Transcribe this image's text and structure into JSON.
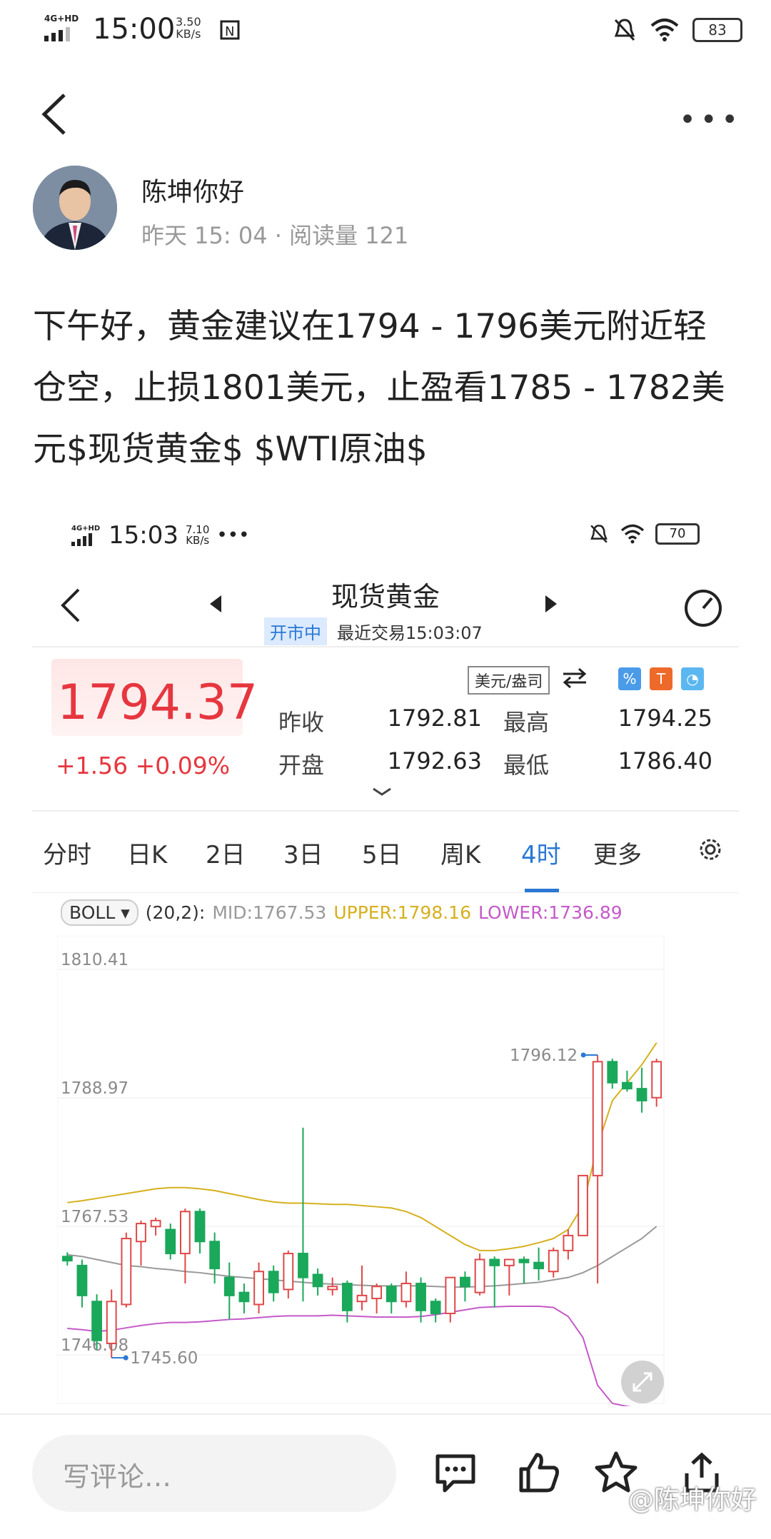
{
  "status_bar": {
    "network": "4G+HD",
    "time": "15:00",
    "speed": "3.50",
    "speed_unit": "KB/s",
    "battery": "83"
  },
  "post": {
    "author": "陈坤你好",
    "time": "昨天 15: 04",
    "reads": "阅读量 121",
    "body": "下午好，黄金建议在1794 - 1796美元附近轻仓空，止损1801美元，止盈看1785 - 1782美元$现货黄金$ $WTI原油$"
  },
  "embedded": {
    "status_bar": {
      "network": "4G+HD",
      "time": "15:03",
      "speed": "7.10",
      "speed_unit": "KB/s",
      "battery": "70"
    },
    "title": "现货黄金",
    "market_status": "开市中",
    "last_trade": "最近交易15:03:07",
    "price": "1794.37",
    "change": "+1.56 +0.09%",
    "unit": "美元/盎司",
    "quote": {
      "prev_close_label": "昨收",
      "prev_close": "1792.81",
      "high_label": "最高",
      "high": "1794.25",
      "open_label": "开盘",
      "open": "1792.63",
      "low_label": "最低",
      "low": "1786.40"
    },
    "tabs": [
      "分时",
      "日K",
      "2日",
      "3日",
      "5日",
      "周K",
      "4时",
      "更多"
    ],
    "active_tab": "4时",
    "indicator": {
      "name": "BOLL",
      "params": "(20,2):",
      "mid": "MID:1767.53",
      "upper": "UPPER:1798.16",
      "lower": "LOWER:1736.89"
    },
    "colors": {
      "up": "#e04848",
      "down": "#1aa85a",
      "mid": "#999999",
      "upper": "#d6b01e",
      "lower": "#c45ac9",
      "accent": "#2b78d6"
    }
  },
  "chart_data": {
    "type": "candlestick",
    "y_ticks": [
      "1810.41",
      "1788.97",
      "1767.53",
      "1746.08"
    ],
    "annotations": {
      "high": "1796.12",
      "low": "1745.60"
    },
    "candles": [
      {
        "o": 1762.5,
        "h": 1763.2,
        "l": 1761.0,
        "c": 1761.8
      },
      {
        "o": 1761.0,
        "h": 1762.0,
        "l": 1754.0,
        "c": 1756.0
      },
      {
        "o": 1755.0,
        "h": 1756.2,
        "l": 1747.0,
        "c": 1748.5
      },
      {
        "o": 1748.0,
        "h": 1757.0,
        "l": 1745.6,
        "c": 1755.0
      },
      {
        "o": 1754.5,
        "h": 1766.5,
        "l": 1754.0,
        "c": 1765.5
      },
      {
        "o": 1765.0,
        "h": 1768.5,
        "l": 1761.0,
        "c": 1768.0
      },
      {
        "o": 1767.5,
        "h": 1769.0,
        "l": 1766.0,
        "c": 1768.5
      },
      {
        "o": 1767.0,
        "h": 1768.0,
        "l": 1762.0,
        "c": 1763.0
      },
      {
        "o": 1763.0,
        "h": 1770.5,
        "l": 1758.0,
        "c": 1770.0
      },
      {
        "o": 1770.0,
        "h": 1770.5,
        "l": 1763.0,
        "c": 1765.0
      },
      {
        "o": 1765.0,
        "h": 1766.5,
        "l": 1758.0,
        "c": 1760.5
      },
      {
        "o": 1759.0,
        "h": 1761.5,
        "l": 1752.0,
        "c": 1756.0
      },
      {
        "o": 1756.5,
        "h": 1758.0,
        "l": 1753.0,
        "c": 1755.0
      },
      {
        "o": 1754.5,
        "h": 1761.5,
        "l": 1753.0,
        "c": 1760.0
      },
      {
        "o": 1760.0,
        "h": 1761.0,
        "l": 1755.0,
        "c": 1756.5
      },
      {
        "o": 1757.0,
        "h": 1763.5,
        "l": 1755.5,
        "c": 1763.0
      },
      {
        "o": 1763.0,
        "h": 1784.0,
        "l": 1755.0,
        "c": 1759.0
      },
      {
        "o": 1759.5,
        "h": 1760.5,
        "l": 1756.0,
        "c": 1757.5
      },
      {
        "o": 1757.0,
        "h": 1759.0,
        "l": 1756.0,
        "c": 1757.5
      },
      {
        "o": 1758.0,
        "h": 1758.5,
        "l": 1751.5,
        "c": 1753.5
      },
      {
        "o": 1755.0,
        "h": 1761.0,
        "l": 1753.5,
        "c": 1756.0
      },
      {
        "o": 1755.5,
        "h": 1758.0,
        "l": 1753.0,
        "c": 1757.5
      },
      {
        "o": 1757.5,
        "h": 1758.0,
        "l": 1753.0,
        "c": 1755.0
      },
      {
        "o": 1755.0,
        "h": 1760.0,
        "l": 1754.0,
        "c": 1758.0
      },
      {
        "o": 1758.0,
        "h": 1759.0,
        "l": 1751.5,
        "c": 1753.5
      },
      {
        "o": 1755.0,
        "h": 1755.5,
        "l": 1751.5,
        "c": 1753.0
      },
      {
        "o": 1753.0,
        "h": 1759.0,
        "l": 1751.5,
        "c": 1759.0
      },
      {
        "o": 1759.0,
        "h": 1760.0,
        "l": 1755.0,
        "c": 1757.5
      },
      {
        "o": 1756.5,
        "h": 1763.0,
        "l": 1756.0,
        "c": 1762.0
      },
      {
        "o": 1762.0,
        "h": 1762.5,
        "l": 1754.0,
        "c": 1761.0
      },
      {
        "o": 1761.0,
        "h": 1762.0,
        "l": 1756.0,
        "c": 1762.0
      },
      {
        "o": 1762.0,
        "h": 1762.5,
        "l": 1758.0,
        "c": 1761.5
      },
      {
        "o": 1761.5,
        "h": 1764.0,
        "l": 1758.5,
        "c": 1760.5
      },
      {
        "o": 1760.0,
        "h": 1764.0,
        "l": 1759.0,
        "c": 1763.5
      },
      {
        "o": 1763.5,
        "h": 1767.0,
        "l": 1762.0,
        "c": 1766.0
      },
      {
        "o": 1766.0,
        "h": 1776.0,
        "l": 1766.0,
        "c": 1776.0
      },
      {
        "o": 1776.0,
        "h": 1796.12,
        "l": 1758.0,
        "c": 1795.0
      },
      {
        "o": 1795.0,
        "h": 1795.5,
        "l": 1790.5,
        "c": 1791.5
      },
      {
        "o": 1791.5,
        "h": 1793.5,
        "l": 1790.0,
        "c": 1790.5
      },
      {
        "o": 1790.5,
        "h": 1794.0,
        "l": 1786.5,
        "c": 1788.5
      },
      {
        "o": 1789.0,
        "h": 1795.5,
        "l": 1787.5,
        "c": 1795.0
      }
    ],
    "mid": [
      1762.8,
      1762.5,
      1762.0,
      1761.5,
      1761.0,
      1760.8,
      1760.5,
      1760.3,
      1760.0,
      1759.8,
      1759.5,
      1759.2,
      1759.0,
      1758.8,
      1758.6,
      1758.4,
      1758.2,
      1758.0,
      1757.9,
      1757.8,
      1757.7,
      1757.6,
      1757.6,
      1757.6,
      1757.6,
      1757.5,
      1757.4,
      1757.4,
      1757.5,
      1757.6,
      1757.8,
      1758.0,
      1758.2,
      1758.6,
      1759.0,
      1759.8,
      1761.0,
      1762.5,
      1764.0,
      1765.5,
      1767.53
    ],
    "upper": [
      1771.5,
      1771.8,
      1772.2,
      1772.6,
      1773.0,
      1773.4,
      1773.8,
      1774.0,
      1774.0,
      1773.8,
      1773.5,
      1773.0,
      1772.5,
      1772.0,
      1771.6,
      1771.4,
      1771.4,
      1771.3,
      1771.2,
      1771.2,
      1771.0,
      1770.8,
      1770.6,
      1770.0,
      1769.0,
      1767.5,
      1766.0,
      1764.5,
      1763.5,
      1763.5,
      1763.8,
      1764.2,
      1764.8,
      1765.5,
      1767.0,
      1771.0,
      1781.0,
      1788.5,
      1791.5,
      1794.5,
      1798.16
    ],
    "lower": [
      1750.5,
      1750.3,
      1750.0,
      1750.2,
      1750.6,
      1751.0,
      1751.3,
      1751.5,
      1751.5,
      1751.6,
      1751.8,
      1752.0,
      1752.1,
      1752.3,
      1752.5,
      1752.6,
      1752.6,
      1752.6,
      1752.7,
      1752.6,
      1752.5,
      1752.4,
      1752.4,
      1752.4,
      1752.5,
      1752.8,
      1753.2,
      1753.6,
      1754.0,
      1754.1,
      1754.2,
      1754.2,
      1754.2,
      1754.0,
      1752.5,
      1749.0,
      1741.0,
      1738.0,
      1737.5,
      1737.2,
      1736.89
    ]
  },
  "bottom_bar": {
    "comment_placeholder": "写评论…",
    "watermark": "@陈坤你好"
  }
}
